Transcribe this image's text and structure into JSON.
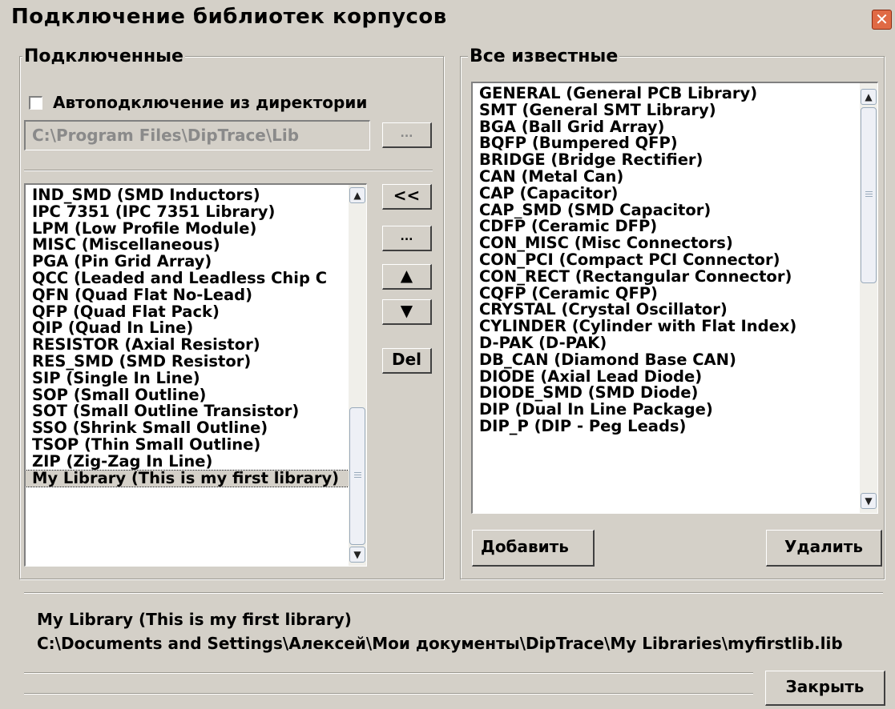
{
  "window": {
    "title": "Подключение библиотек корпусов"
  },
  "connected": {
    "group_title": "Подключенные",
    "auto_connect_label": "Автоподключение из директории",
    "directory_value": "C:\\Program Files\\DipTrace\\Lib",
    "browse_label": "...",
    "items": [
      "IND_SMD (SMD Inductors)",
      "IPC 7351 (IPC 7351 Library)",
      "LPM (Low Profile Module)",
      "MISC (Miscellaneous)",
      "PGA (Pin Grid Array)",
      "QCC (Leaded and Leadless Chip C",
      "QFN (Quad Flat No-Lead)",
      "QFP (Quad Flat Pack)",
      "QIP (Quad In Line)",
      "RESISTOR (Axial Resistor)",
      "RES_SMD (SMD Resistor)",
      "SIP (Single In Line)",
      "SOP (Small Outline)",
      "SOT (Small Outline Transistor)",
      "SSO (Shrink Small Outline)",
      "TSOP (Thin Small Outline)",
      "ZIP (Zig-Zag In Line)",
      "My Library (This is my first library)"
    ],
    "selected_index": 17
  },
  "middle_buttons": {
    "move_left": "<<",
    "more": "...",
    "up": "▲",
    "down": "▼",
    "delete": "Del"
  },
  "known": {
    "group_title": "Все известные",
    "items": [
      "GENERAL (General PCB Library)",
      "SMT (General SMT Library)",
      "BGA (Ball Grid Array)",
      "BQFP (Bumpered QFP)",
      "BRIDGE (Bridge Rectifier)",
      "CAN (Metal Can)",
      "CAP (Capacitor)",
      "CAP_SMD (SMD Capacitor)",
      "CDFP (Ceramic DFP)",
      "CON_MISC (Misc Connectors)",
      "CON_PCI (Compact PCI Connector)",
      "CON_RECT (Rectangular Connector)",
      "CQFP (Ceramic QFP)",
      "CRYSTAL (Crystal Oscillator)",
      "CYLINDER (Cylinder with Flat Index)",
      "D-PAK (D-PAK)",
      "DB_CAN (Diamond Base CAN)",
      "DIODE (Axial Lead Diode)",
      "DIODE_SMD (SMD Diode)",
      "DIP (Dual In Line Package)",
      "DIP_P (DIP - Peg Leads)"
    ],
    "add_label": "Добавить",
    "remove_label": "Удалить"
  },
  "info": {
    "library_name": "My Library (This is my first library)",
    "library_path": "C:\\Documents and Settings\\Алексей\\Мои документы\\DipTrace\\My Libraries\\myfirstlib.lib"
  },
  "footer": {
    "close_label": "Закрыть"
  }
}
